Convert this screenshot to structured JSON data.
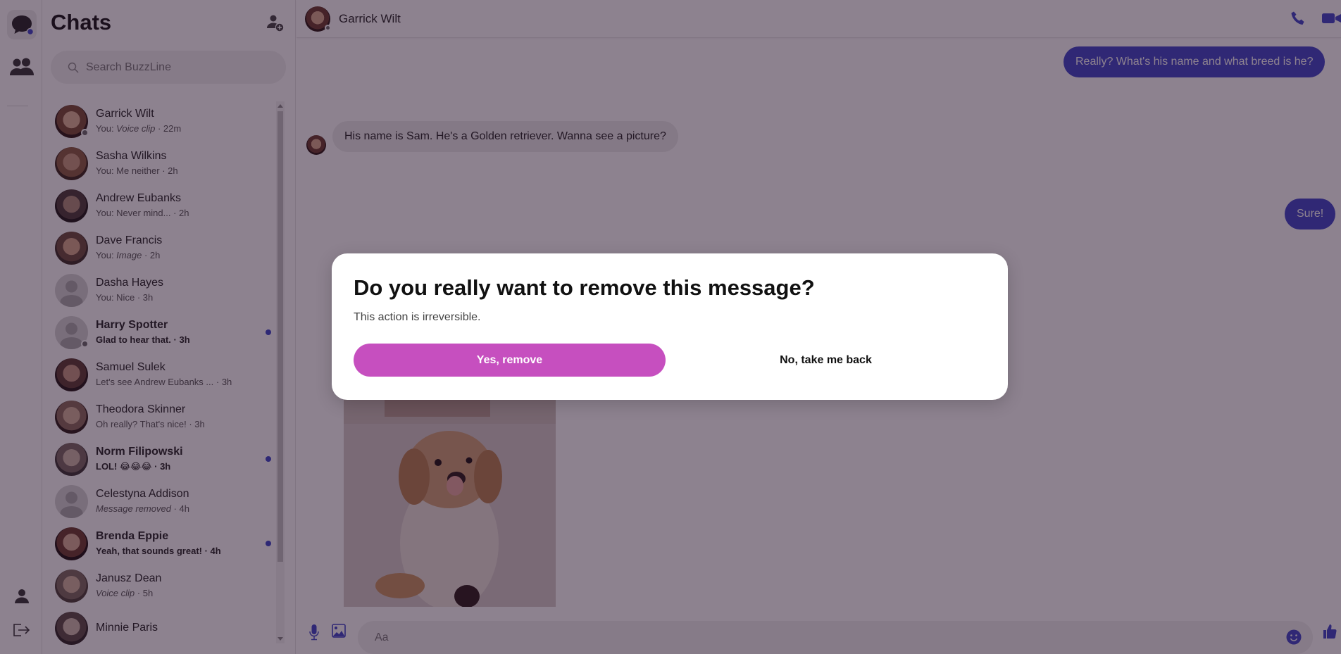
{
  "app": {
    "name": "BuzzLine",
    "accent": "#3d44c8",
    "danger_accent": "#c64fbf"
  },
  "rail": {
    "items": [
      {
        "name": "chats",
        "icon": "chat-bubble-icon",
        "active": true,
        "badge": true
      },
      {
        "name": "people",
        "icon": "people-icon",
        "active": false
      }
    ],
    "bottom": [
      {
        "name": "profile",
        "icon": "person-icon"
      },
      {
        "name": "logout",
        "icon": "logout-icon"
      }
    ]
  },
  "sidebar": {
    "title": "Chats",
    "new_chat_icon": "add-person-icon",
    "search_placeholder": "Search BuzzLine",
    "chats": [
      {
        "name": "Garrick Wilt",
        "prefix": "You: ",
        "preview": "Voice clip",
        "preview_italic": true,
        "time": "· 22m",
        "unread": false,
        "presence": true,
        "avatar": "photo"
      },
      {
        "name": "Sasha Wilkins",
        "prefix": "You: ",
        "preview": "Me neither",
        "preview_italic": false,
        "time": "· 2h",
        "unread": false,
        "presence": false,
        "avatar": "photo"
      },
      {
        "name": "Andrew Eubanks",
        "prefix": "You: ",
        "preview": "Never mind...",
        "preview_italic": false,
        "time": "· 2h",
        "unread": false,
        "presence": false,
        "avatar": "photo"
      },
      {
        "name": "Dave Francis",
        "prefix": "You: ",
        "preview": "Image",
        "preview_italic": true,
        "time": "· 2h",
        "unread": false,
        "presence": false,
        "avatar": "photo"
      },
      {
        "name": "Dasha Hayes",
        "prefix": "You: ",
        "preview": "Nice",
        "preview_italic": false,
        "time": "· 3h",
        "unread": false,
        "presence": false,
        "avatar": "placeholder"
      },
      {
        "name": "Harry Spotter",
        "prefix": "",
        "preview": "Glad to hear that.",
        "preview_italic": false,
        "time": "· 3h",
        "unread": true,
        "presence": true,
        "avatar": "placeholder"
      },
      {
        "name": "Samuel Sulek",
        "prefix": "",
        "preview": "Let's see Andrew Eubanks ...",
        "preview_italic": false,
        "time": "· 3h",
        "unread": false,
        "presence": false,
        "avatar": "photo"
      },
      {
        "name": "Theodora Skinner",
        "prefix": "",
        "preview": "Oh really? That's nice!",
        "preview_italic": false,
        "time": "· 3h",
        "unread": false,
        "presence": false,
        "avatar": "photo"
      },
      {
        "name": "Norm Filipowski",
        "prefix": "",
        "preview": "LOL! 😂😂😂",
        "preview_italic": false,
        "time": "· 3h",
        "unread": true,
        "presence": false,
        "avatar": "photo"
      },
      {
        "name": "Celestyna Addison",
        "prefix": "",
        "preview": "Message removed",
        "preview_italic": true,
        "time": "· 4h",
        "unread": false,
        "presence": false,
        "avatar": "placeholder"
      },
      {
        "name": "Brenda Eppie",
        "prefix": "",
        "preview": "Yeah, that sounds great!",
        "preview_italic": false,
        "time": "· 4h",
        "unread": true,
        "presence": false,
        "avatar": "photo"
      },
      {
        "name": "Janusz Dean",
        "prefix": "",
        "preview": "Voice clip",
        "preview_italic": true,
        "time": "· 5h",
        "unread": false,
        "presence": false,
        "avatar": "photo"
      },
      {
        "name": "Minnie Paris",
        "prefix": "",
        "preview": "",
        "preview_italic": false,
        "time": "",
        "unread": false,
        "presence": false,
        "avatar": "photo"
      }
    ]
  },
  "conversation": {
    "contact_name": "Garrick Wilt",
    "header_icons": [
      "phone-icon",
      "video-camera-icon"
    ],
    "messages": [
      {
        "direction": "out",
        "text": "Really? What's his name and what breed is he?"
      },
      {
        "direction": "in",
        "text": "His name is Sam. He's a Golden retriever. Wanna see a picture?"
      },
      {
        "direction": "out",
        "text": "Sure!"
      },
      {
        "direction": "in",
        "type": "image",
        "alt": "Golden retriever puppy"
      }
    ],
    "composer": {
      "placeholder": "Aa",
      "value": "",
      "left_icons": [
        "microphone-icon",
        "image-icon"
      ],
      "right_icons": [
        "emoji-icon",
        "thumbs-up-icon"
      ]
    }
  },
  "dialog": {
    "title": "Do you really want to remove this message?",
    "subtitle": "This action is irreversible.",
    "confirm_label": "Yes, remove",
    "cancel_label": "No, take me back"
  }
}
